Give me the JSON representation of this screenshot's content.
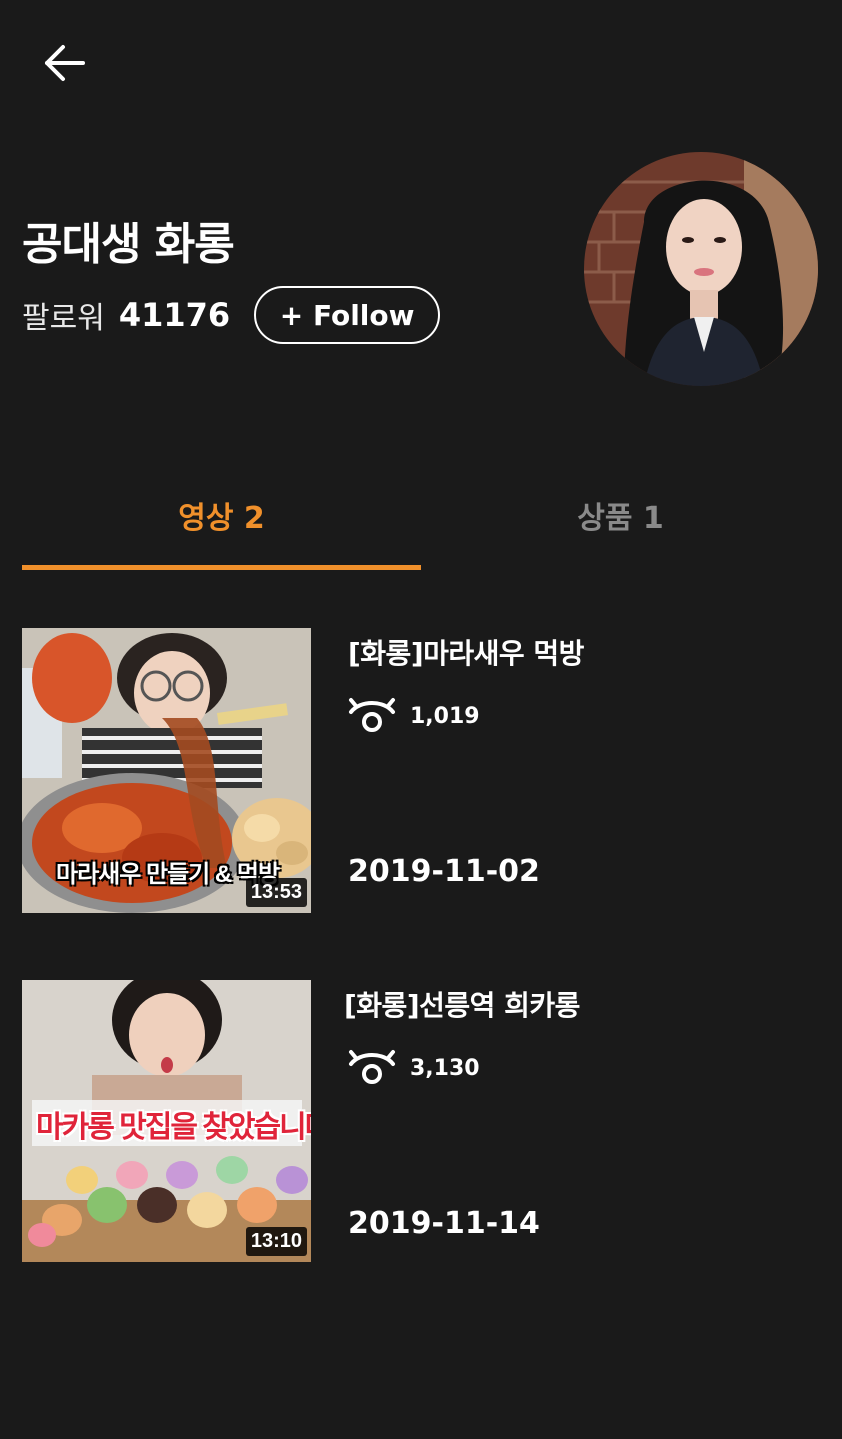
{
  "header": {
    "back_icon": "arrow-left-icon"
  },
  "profile": {
    "name": "공대생 화롱",
    "followers_label": "팔로워",
    "followers_count": "41176",
    "follow_button": "+ Follow",
    "avatar": "profile-photo"
  },
  "tabs": [
    {
      "label": "영상 2",
      "active": true
    },
    {
      "label": "상품 1",
      "active": false
    }
  ],
  "videos": [
    {
      "title": "[화롱]마라새우 먹방",
      "views": "1,019",
      "date": "2019-11-02",
      "duration": "13:53",
      "thumb_caption": "마라새우 만들기 & 먹방"
    },
    {
      "title": "[화롱]선릉역 희카롱",
      "views": "3,130",
      "date": "2019-11-14",
      "duration": "13:10",
      "thumb_caption": "마카롱 맛집을 찾았습니다"
    }
  ],
  "colors": {
    "background": "#1a1a1a",
    "accent": "#f0902b",
    "inactive_tab": "#8a8a8a"
  }
}
